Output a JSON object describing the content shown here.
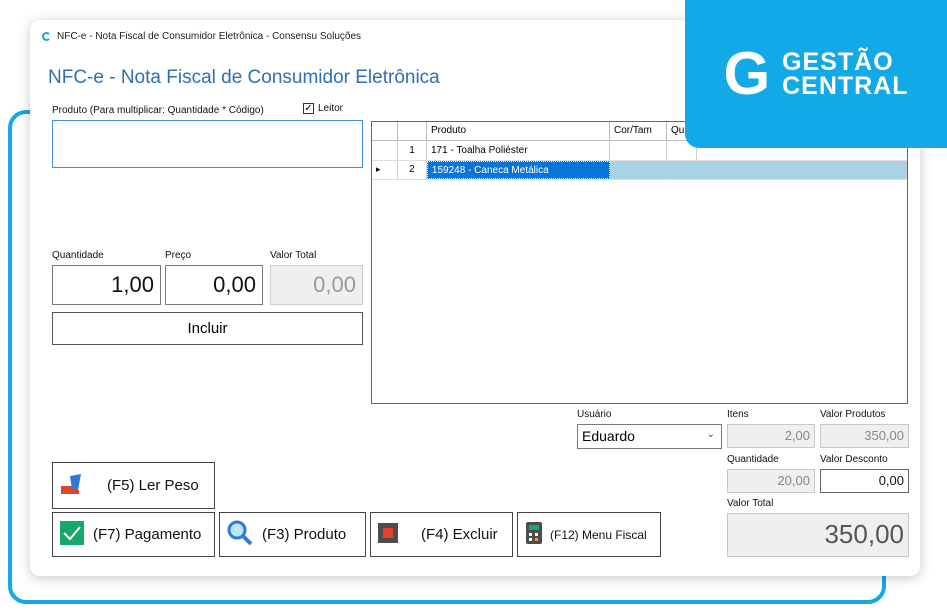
{
  "window_title": "NFC-e - Nota Fiscal de Consumidor Eletrônica - Consensu Soluções",
  "main_title": "NFC-e - Nota Fiscal de Consumidor Eletrônica",
  "brand": {
    "line1": "GESTÃO",
    "line2": "CENTRAL",
    "color": "#13a9e6"
  },
  "produto": {
    "label": "Produto (Para multiplicar: Quantidade * Código)",
    "value": "",
    "leitor_label": "Leitor",
    "leitor_checked": true
  },
  "quantidade": {
    "label": "Quantidade",
    "value": "1,00"
  },
  "preco": {
    "label": "Preço",
    "value": "0,00"
  },
  "valor_total_item": {
    "label": "Valor Total",
    "value": "0,00"
  },
  "incluir_label": "Incluir",
  "grid": {
    "columns": [
      "Produto",
      "Cor/Tam",
      "Qu"
    ],
    "rows": [
      {
        "marker": "",
        "num": "1",
        "produto": "171 - Toalha Poliéster",
        "selected": false
      },
      {
        "marker": "▸",
        "num": "2",
        "produto": "159248 - Caneca Metálica",
        "selected": true
      }
    ]
  },
  "usuario": {
    "label": "Usuário",
    "value": "Eduardo"
  },
  "itens": {
    "label": "Itens",
    "value": "2,00"
  },
  "valor_produtos": {
    "label": "Valor Produtos",
    "value": "350,00"
  },
  "quantidade_total": {
    "label": "Quantidade",
    "value": "20,00"
  },
  "valor_desconto": {
    "label": "Valor Desconto",
    "value": "0,00"
  },
  "valor_total": {
    "label": "Valor Total",
    "value": "350,00"
  },
  "buttons": {
    "ler_peso": "(F5) Ler Peso",
    "pagamento": "(F7) Pagamento",
    "produto": "(F3) Produto",
    "excluir": "(F4) Excluir",
    "menu_fiscal": "(F12) Menu Fiscal"
  }
}
